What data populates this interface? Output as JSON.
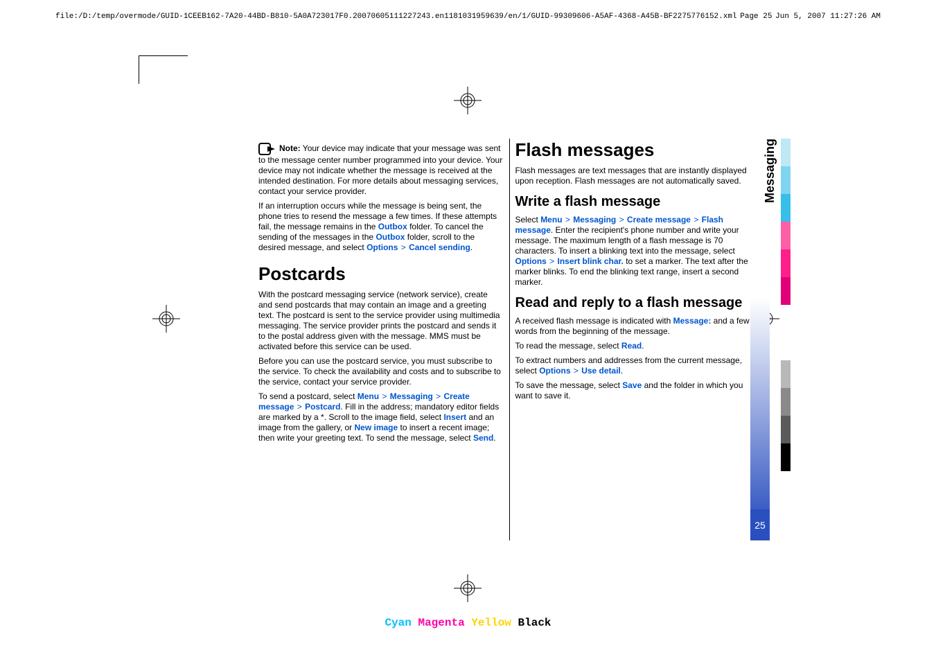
{
  "header": {
    "path": "file:/D:/temp/overmode/GUID-1CEEB162-7A20-44BD-B810-5A0A723017F0.20070605111227243.en1181031959639/en/1/GUID-99309606-A5AF-4368-A45B-BF2275776152.xml",
    "page": "Page 25",
    "timestamp": "Jun 5, 2007 11:27:26 AM"
  },
  "side_tab": "Messaging",
  "page_number": "25",
  "col1": {
    "note_label": "Note:",
    "note_body": " Your device may indicate that your message was sent to the message center number programmed into your device. Your device may not indicate whether the message is received at the intended destination. For more details about messaging services, contact your service provider.",
    "p2a": "If an interruption occurs while the message is being sent, the phone tries to resend the message a few times. If these attempts fail, the message remains in the ",
    "outbox": "Outbox",
    "p2b": " folder. To cancel the sending of the messages in the ",
    "p2c": " folder, scroll to the desired message, and select ",
    "options": "Options",
    "cancel": "Cancel sending",
    "postcards_h": "Postcards",
    "p3": "With the postcard messaging service (network service), create and send postcards that may contain an image and a greeting text. The postcard is sent to the service provider using multimedia messaging. The service provider prints the postcard and sends it to the postal address given with the message. MMS must be activated before this service can be used.",
    "p4": "Before you can use the postcard service, you must subscribe to the service. To check the availability and costs and to subscribe to the service, contact your service provider.",
    "p5a": "To send a postcard, select ",
    "menu": "Menu",
    "messaging": "Messaging",
    "create_msg": "Create message",
    "postcard": "Postcard",
    "p5b": ". Fill in the address; mandatory editor fields are marked by a *. Scroll to the image field, select ",
    "insert": "Insert",
    "p5c": " and an image from the gallery, or ",
    "new_image": "New image",
    "p5d": " to insert a recent image; then write your greeting text. To send the message, select ",
    "send": "Send"
  },
  "col2": {
    "flash_h": "Flash messages",
    "p1": "Flash messages are text messages that are instantly displayed upon reception. Flash messages are not automatically saved.",
    "write_h": "Write a flash message",
    "p2a": "Select ",
    "menu": "Menu",
    "messaging": "Messaging",
    "create_msg": "Create message",
    "flash_msg": "Flash message",
    "p2b": ". Enter the recipient's phone number and write your message. The maximum length of a flash message is 70 characters. To insert a blinking text into the message, select ",
    "options": "Options",
    "insert_blink": "Insert blink char.",
    "p2c": " to set a marker. The text after the marker blinks. To end the blinking text range, insert a second marker.",
    "read_h": "Read and reply to a flash message",
    "p3a": "A received flash message is indicated with ",
    "message_lbl": "Message:",
    "p3b": " and a few words from the beginning of the message.",
    "p4a": "To read the message, select ",
    "read": "Read",
    "p5a": "To extract numbers and addresses from the current message, select ",
    "use_detail": "Use detail",
    "p6a": "To save the message, select ",
    "save": "Save",
    "p6b": " and the folder in which you want to save it."
  },
  "cmyk": {
    "c": "Cyan",
    "m": "Magenta",
    "y": "Yellow",
    "k": "Black"
  },
  "colorbars": [
    "#bde8f4",
    "#7fd4f0",
    "#37bfe8",
    "#ff5fa5",
    "#ff1f8a",
    "#e0007a",
    "#ffffff",
    "#ffffff",
    "#b8b8b8",
    "#8a8a8a",
    "#5a5a5a",
    "#000000"
  ]
}
